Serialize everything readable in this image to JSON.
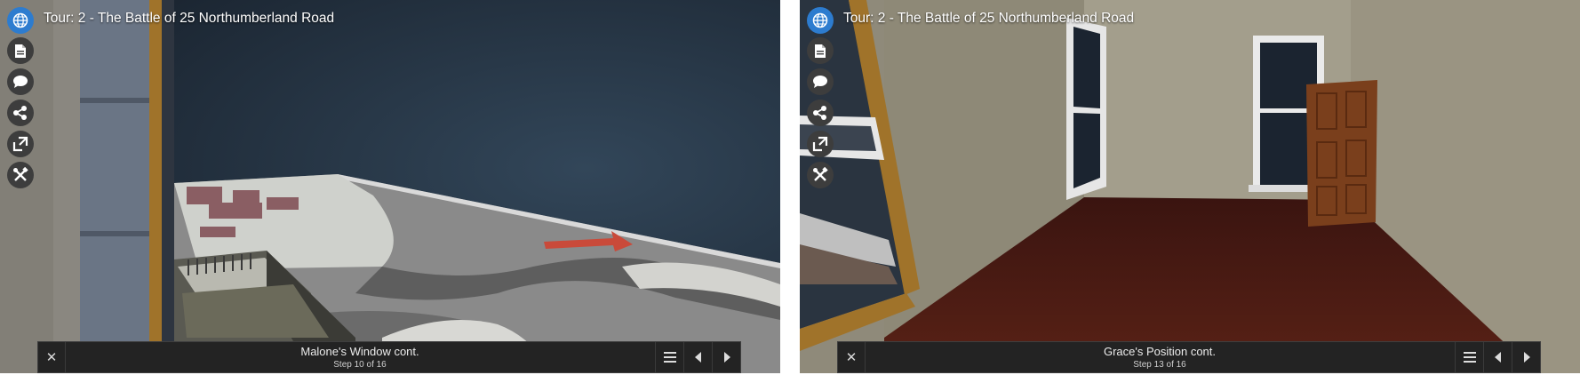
{
  "panels": [
    {
      "title": "Tour: 2 - The Battle of 25 Northumberland Road",
      "step_title": "Malone's Window cont.",
      "step_counter": "Step 10 of 16"
    },
    {
      "title": "Tour: 2 - The Battle of 25 Northumberland Road",
      "step_title": "Grace's Position cont.",
      "step_counter": "Step 13 of 16"
    }
  ],
  "controls": {
    "close_glyph": "✕",
    "rail_icons": [
      "globe-icon",
      "document-icon",
      "comment-icon",
      "share-icon",
      "fullscreen-icon",
      "tools-icon"
    ],
    "nav_icons": [
      "menu-icon",
      "previous-icon",
      "next-icon"
    ]
  },
  "colors": {
    "globe_button": "#2d7ccf",
    "rail_button": "#3d3d3d",
    "step_bar": "#232323",
    "sky": "#1e2a38",
    "floor": "#4a1a14",
    "wall": "#9b9583"
  }
}
